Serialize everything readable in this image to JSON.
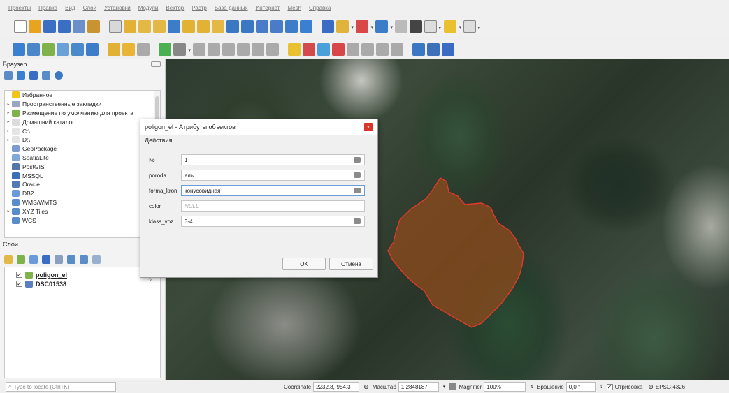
{
  "menubar": [
    "Проекты",
    "Правка",
    "Вид",
    "Слой",
    "Установки",
    "Модули",
    "Вектор",
    "Растр",
    "База данных",
    "Интернет",
    "Mesh",
    "Справка"
  ],
  "toolbars": {
    "row1": [
      {
        "icon": "new-project-icon",
        "color": "#ffffff"
      },
      {
        "icon": "open-project-icon",
        "color": "#e8a320"
      },
      {
        "icon": "save-project-icon",
        "color": "#3b6fc4"
      },
      {
        "icon": "save-as-icon",
        "color": "#3b6fc4"
      },
      {
        "icon": "print-layout-icon",
        "color": "#6a8fc9"
      },
      {
        "icon": "style-manager-icon",
        "color": "#c89432"
      },
      {
        "icon": "pan-icon",
        "color": "#d8d8d8"
      },
      {
        "icon": "pan-to-selection-icon",
        "color": "#e2b234"
      },
      {
        "icon": "zoom-in-icon",
        "color": "#e3b845"
      },
      {
        "icon": "zoom-out-icon",
        "color": "#e3b845"
      },
      {
        "icon": "zoom-full-icon",
        "color": "#3c7cc8"
      },
      {
        "icon": "zoom-to-selection-icon",
        "color": "#e2b234"
      },
      {
        "icon": "zoom-to-layer-icon",
        "color": "#e2b234"
      },
      {
        "icon": "zoom-native-icon",
        "color": "#e3b845"
      },
      {
        "icon": "zoom-last-icon",
        "color": "#3a78c4"
      },
      {
        "icon": "zoom-next-icon",
        "color": "#3a78c4"
      },
      {
        "icon": "new-map-view-icon",
        "color": "#4a7bc8"
      },
      {
        "icon": "new-bookmark-icon",
        "color": "#4a7bc8"
      },
      {
        "icon": "show-bookmarks-icon",
        "color": "#3c7cc8"
      },
      {
        "icon": "refresh-icon",
        "color": "#3b7fd0"
      },
      {
        "icon": "identify-icon",
        "color": "#3a6cc4"
      },
      {
        "icon": "select-features-icon",
        "color": "#e0b33a"
      },
      {
        "icon": "deselect-icon",
        "color": "#d84848"
      },
      {
        "icon": "open-attribute-table-icon",
        "color": "#3c7cc8"
      },
      {
        "icon": "field-calculator-icon",
        "color": "#bbbbbb"
      },
      {
        "icon": "statistics-icon",
        "color": "#444444"
      },
      {
        "icon": "measure-icon",
        "color": "#dddddd"
      },
      {
        "icon": "map-tips-icon",
        "color": "#e8c030"
      },
      {
        "icon": "text-annotation-icon",
        "color": "#dddddd"
      }
    ],
    "row2": [
      {
        "icon": "data-source-manager-icon",
        "color": "#3b7fd0"
      },
      {
        "icon": "new-geopackage-layer-icon",
        "color": "#4a86c8"
      },
      {
        "icon": "new-shapefile-layer-icon",
        "color": "#7fb24a"
      },
      {
        "icon": "new-spatialite-layer-icon",
        "color": "#6aa0d8"
      },
      {
        "icon": "new-temp-layer-icon",
        "color": "#4a8acb"
      },
      {
        "icon": "new-virtual-layer-icon",
        "color": "#3c7cc8"
      },
      {
        "icon": "current-edits-icon",
        "color": "#e2b035"
      },
      {
        "icon": "toggle-editing-icon",
        "color": "#e9b537"
      },
      {
        "icon": "save-layer-edits-icon",
        "color": "#aaaaaa"
      },
      {
        "icon": "add-polygon-icon",
        "color": "#4ab050"
      },
      {
        "icon": "vertex-tool-icon",
        "color": "#888888"
      },
      {
        "icon": "delete-selected-icon",
        "color": "#aaaaaa"
      },
      {
        "icon": "cut-features-icon",
        "color": "#aaaaaa"
      },
      {
        "icon": "copy-features-icon",
        "color": "#aaaaaa"
      },
      {
        "icon": "paste-features-icon",
        "color": "#aaaaaa"
      },
      {
        "icon": "undo-icon",
        "color": "#aaaaaa"
      },
      {
        "icon": "redo-icon",
        "color": "#aaaaaa"
      },
      {
        "icon": "label-tool-icon",
        "color": "#e8c030"
      },
      {
        "icon": "layer-labeling-icon",
        "color": "#d34b4b"
      },
      {
        "icon": "layer-diagram-icon",
        "color": "#4aa0d8"
      },
      {
        "icon": "pin-labels-icon",
        "color": "#d84848"
      },
      {
        "icon": "show-hide-labels-icon",
        "color": "#aaaaaa"
      },
      {
        "icon": "move-label-icon",
        "color": "#aaaaaa"
      },
      {
        "icon": "rotate-label-icon",
        "color": "#aaaaaa"
      },
      {
        "icon": "change-label-icon",
        "color": "#aaaaaa"
      },
      {
        "icon": "digitizer-plugin-icon",
        "color": "#3a78c4"
      },
      {
        "icon": "python-console-icon",
        "color": "#3c70b8"
      },
      {
        "icon": "help-icon",
        "color": "#3a6cc4"
      }
    ]
  },
  "browser": {
    "title": "Браузер",
    "items": [
      {
        "label": "Избранное",
        "icon": "star-icon",
        "color": "#f2c318",
        "arrow": ""
      },
      {
        "label": "Пространственные закладки",
        "icon": "spatial-bookmarks-icon",
        "color": "#9aa7c0",
        "arrow": "▸"
      },
      {
        "label": "Размещение по умолчанию для проекта",
        "icon": "project-home-icon",
        "color": "#7fb24a",
        "arrow": "▸"
      },
      {
        "label": "Домашний каталог",
        "icon": "home-folder-icon",
        "color": "#dcdcdc",
        "arrow": "▸"
      },
      {
        "label": "C:\\",
        "icon": "drive-icon",
        "color": "#e4e4e4",
        "arrow": "▸"
      },
      {
        "label": "D:\\",
        "icon": "drive-icon",
        "color": "#e4e4e4",
        "arrow": "▸"
      },
      {
        "label": "GeoPackage",
        "icon": "geopackage-icon",
        "color": "#7a9bd0",
        "arrow": ""
      },
      {
        "label": "SpatiaLite",
        "icon": "spatialite-icon",
        "color": "#7fa8d8",
        "arrow": ""
      },
      {
        "label": "PostGIS",
        "icon": "postgis-icon",
        "color": "#5475a8",
        "arrow": ""
      },
      {
        "label": "MSSQL",
        "icon": "mssql-icon",
        "color": "#3b6fb8",
        "arrow": ""
      },
      {
        "label": "Oracle",
        "icon": "oracle-icon",
        "color": "#5579b4",
        "arrow": ""
      },
      {
        "label": "DB2",
        "icon": "db2-icon",
        "color": "#6a9bd8",
        "arrow": ""
      },
      {
        "label": "WMS/WMTS",
        "icon": "wms-icon",
        "color": "#5a8cc8",
        "arrow": ""
      },
      {
        "label": "XYZ Tiles",
        "icon": "xyz-tiles-icon",
        "color": "#5a8cc8",
        "arrow": "▸"
      },
      {
        "label": "WCS",
        "icon": "wcs-icon",
        "color": "#5a8cc8",
        "arrow": ""
      }
    ]
  },
  "layers": {
    "title": "Слои",
    "items": [
      {
        "label": "poligon_el",
        "checked": "✓",
        "icon": "polygon-layer-icon",
        "color": "#7fb24a",
        "underline": true
      },
      {
        "label": "DSC01538",
        "checked": "✓",
        "icon": "raster-layer-icon",
        "color": "#5a7fc0",
        "underline": false
      }
    ],
    "help_mark": "?"
  },
  "dialog": {
    "title": "poligon_el - Атрибуты объектов",
    "close": "×",
    "actions_label": "Действия",
    "fields": [
      {
        "label": "№",
        "value": "1",
        "null": false,
        "focus": false
      },
      {
        "label": "poroda",
        "value": "ель",
        "null": false,
        "focus": false
      },
      {
        "label": "forma_kron",
        "value": "конусовидная",
        "null": false,
        "focus": true
      },
      {
        "label": "color",
        "value": "NULL",
        "null": true,
        "focus": false
      },
      {
        "label": "klass_voz",
        "value": "3-4",
        "null": false,
        "focus": false
      }
    ],
    "ok": "OK",
    "cancel": "Отмена"
  },
  "status": {
    "locate_placeholder": "Type to locate (Ctrl+K)",
    "coordinate_label": "Coordinate",
    "coordinate_value": "2232.8,-954.3",
    "scale_label": "Масштаб",
    "scale_value": "1:2848187",
    "magnifier_label": "Magnifier",
    "magnifier_value": "100%",
    "rotation_label": "Вращение",
    "rotation_value": "0,0 °",
    "render_label": "Отрисовка",
    "crs_label": "EPSG:4326"
  },
  "colors": {
    "polygon_fill": "#8a4a1c",
    "polygon_stroke": "#e03a2a",
    "dialog_close": "#d9362a"
  }
}
